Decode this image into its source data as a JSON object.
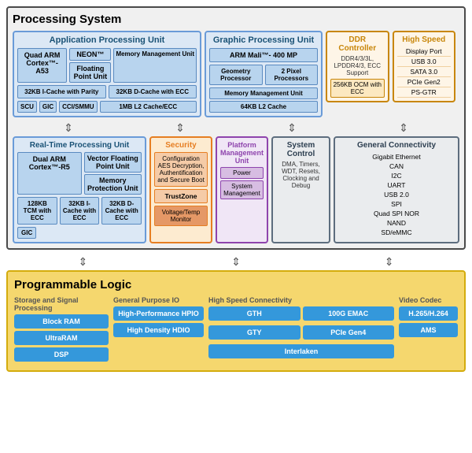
{
  "processingSystem": {
    "title": "Processing System",
    "apu": {
      "title": "Application Processing Unit",
      "cortex": "Quad ARM Cortex™-A53",
      "neon": "NEON™",
      "fpu": "Floating Point Unit",
      "mmu": "Memory Management Unit",
      "icache": "32KB I-Cache with Parity",
      "dcache": "32KB D-Cache with ECC",
      "scu": "SCU",
      "gic": "GIC",
      "ccismmu": "CCI/SMMU",
      "l2": "1MB L2 Cache/ECC"
    },
    "gpu": {
      "title": "Graphic Processing Unit",
      "mali": "ARM Mali™- 400 MP",
      "geo": "Geometry Processor",
      "pixel": "2 Pixel Processors",
      "mmu": "Memory Management Unit",
      "l2": "64KB L2 Cache"
    },
    "ddr": {
      "title": "DDR Controller",
      "content": "DDR4/3/3L, LPDDR4/3, ECC Support",
      "ocm": "256KB OCM with ECC"
    },
    "hs": {
      "title": "High Speed",
      "items": [
        "Display Port",
        "USB 3.0",
        "SATA 3.0",
        "PCIe Gen2",
        "PS-GTR"
      ]
    },
    "rpu": {
      "title": "Real-Time Processing Unit",
      "cortex": "Dual ARM Cortex™-R5",
      "vfp": "Vector Floating Point Unit",
      "mp": "Memory Protection Unit",
      "tcm": "128KB TCM with ECC",
      "icache": "32KB I-Cache with ECC",
      "dcache": "32KB D-Cache with ECC",
      "gic": "GIC"
    },
    "security": {
      "title": "Security",
      "aes": "Configuration AES Decryption, Authentification and Secure Boot",
      "tz": "TrustZone",
      "vt": "Voltage/Temp Monitor"
    },
    "pmu": {
      "title": "Platform Management Unit",
      "power": "Power",
      "sysMan": "System Management"
    },
    "systemControl": {
      "title": "System Control",
      "content": "DMA, Timers, WDT, Resets, Clocking and Debug"
    },
    "gc": {
      "title": "General Connectivity",
      "items": [
        "Gigabit Ethernet",
        "CAN",
        "I2C",
        "UART",
        "USB 2.0",
        "SPI",
        "Quad SPI NOR",
        "NAND",
        "SD/eMMC"
      ]
    }
  },
  "programmableLogic": {
    "title": "Programmable Logic",
    "storage": {
      "title": "Storage and Signal Processing",
      "items": [
        "Block RAM",
        "UltraRAM",
        "DSP"
      ]
    },
    "gpio": {
      "title": "General Purpose IO",
      "items": [
        "High-Performance HPIO",
        "High Density HDIO"
      ]
    },
    "hsConn": {
      "title": "High Speed Connectivity",
      "items": [
        "GTH",
        "100G EMAC",
        "GTY",
        "PCIe Gen4",
        "Interlaken"
      ]
    },
    "video": {
      "title": "Video Codec",
      "items": [
        "H.265/H.264",
        "AMS"
      ]
    }
  }
}
